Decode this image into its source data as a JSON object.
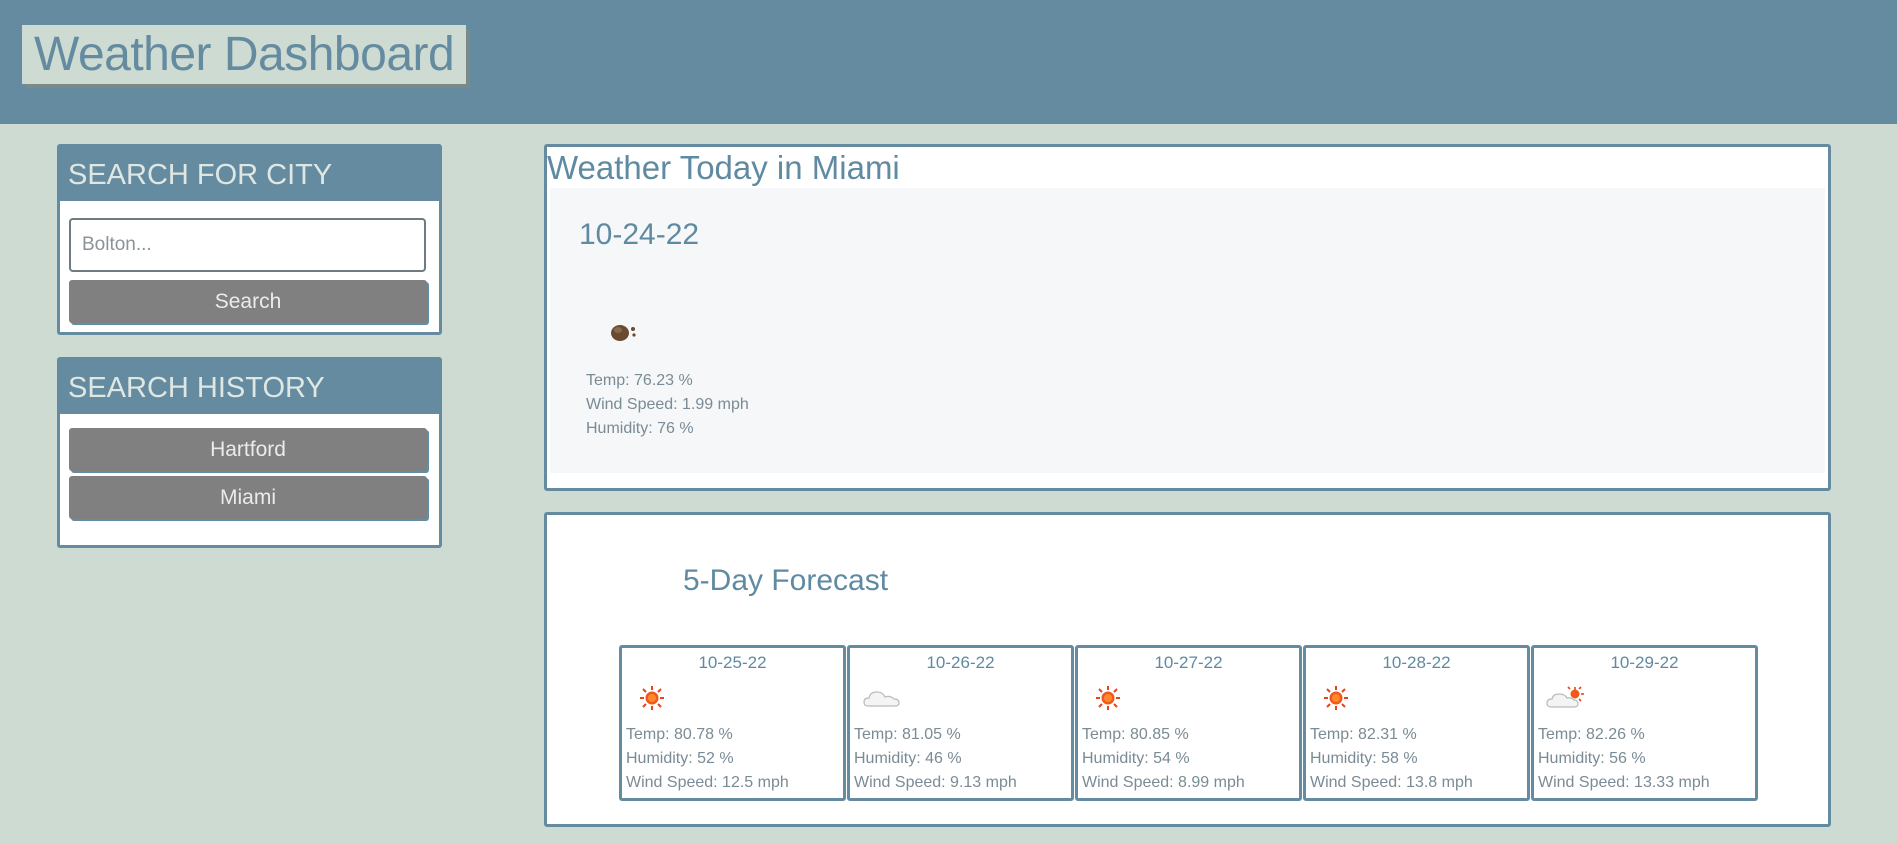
{
  "header": {
    "title": "Weather Dashboard"
  },
  "search": {
    "heading": "SEARCH FOR CITY",
    "placeholder": "Bolton...",
    "button_label": "Search"
  },
  "history": {
    "heading": "SEARCH HISTORY",
    "items": [
      "Hartford",
      "Miami"
    ]
  },
  "today": {
    "title": "Weather Today in Miami",
    "date": "10-24-22",
    "icon": "dust-icon",
    "temp": "Temp: 76.23 %",
    "wind": "Wind Speed: 1.99 mph",
    "humidity": "Humidity: 76 %"
  },
  "forecast": {
    "title": "5-Day Forecast",
    "days": [
      {
        "date": "10-25-22",
        "icon": "sun-icon",
        "temp": "Temp: 80.78 %",
        "humidity": "Humidity: 52 %",
        "wind": "Wind Speed: 12.5 mph"
      },
      {
        "date": "10-26-22",
        "icon": "cloud-icon",
        "temp": "Temp: 81.05 %",
        "humidity": "Humidity: 46 %",
        "wind": "Wind Speed: 9.13 mph"
      },
      {
        "date": "10-27-22",
        "icon": "sun-icon",
        "temp": "Temp: 80.85 %",
        "humidity": "Humidity: 54 %",
        "wind": "Wind Speed: 8.99 mph"
      },
      {
        "date": "10-28-22",
        "icon": "sun-icon",
        "temp": "Temp: 82.31 %",
        "humidity": "Humidity: 58 %",
        "wind": "Wind Speed: 13.8 mph"
      },
      {
        "date": "10-29-22",
        "icon": "partly-cloudy-icon",
        "temp": "Temp: 82.26 %",
        "humidity": "Humidity: 56 %",
        "wind": "Wind Speed: 13.33 mph"
      }
    ]
  }
}
